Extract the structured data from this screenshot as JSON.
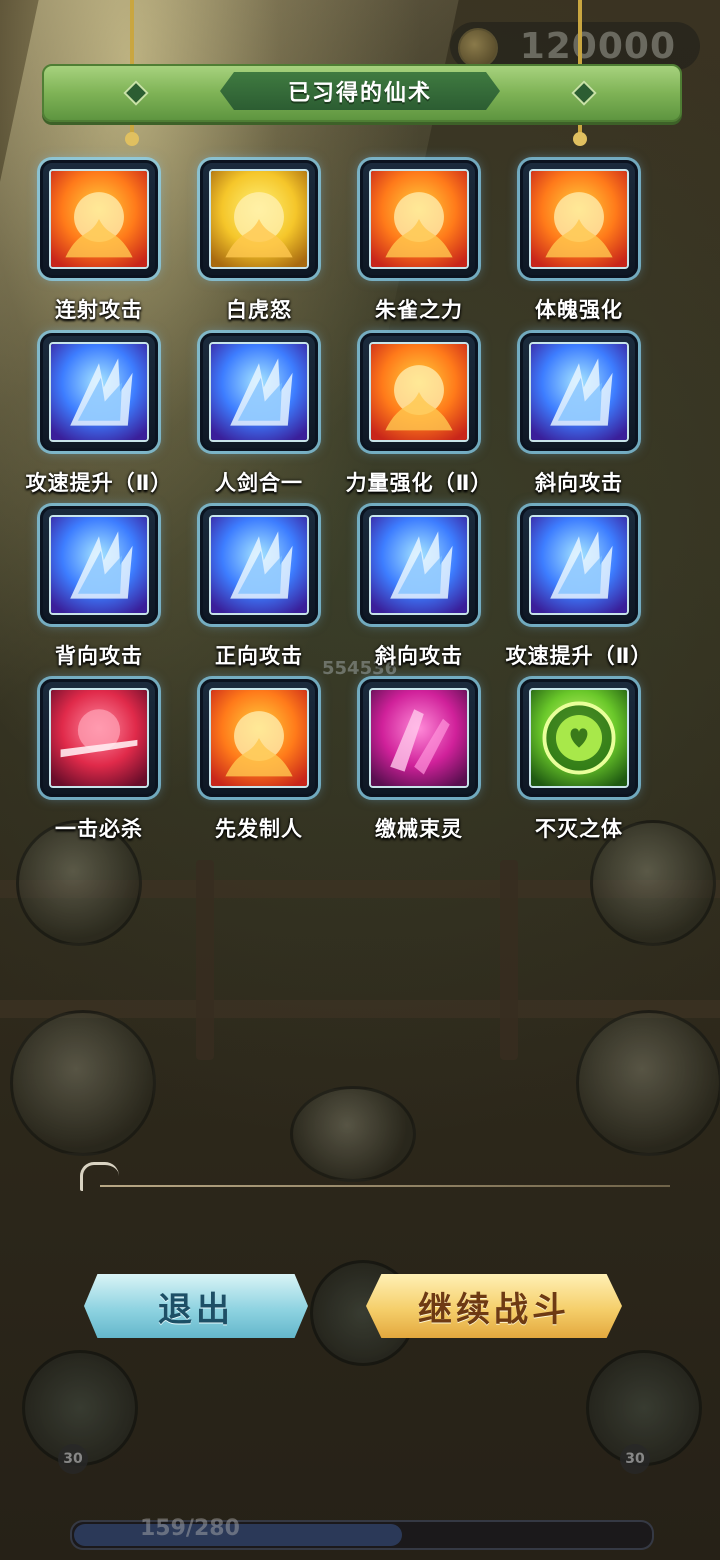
{
  "hud": {
    "coins": "120000",
    "hp_text": "159/280",
    "hp_fraction": 0.57,
    "damage_number": "554536",
    "skill_level_left": "30",
    "skill_level_right": "30"
  },
  "panel": {
    "title": "已习得的仙术"
  },
  "skills": [
    {
      "name": "连射攻击",
      "icon": "fire-orb-icon",
      "theme": "fire"
    },
    {
      "name": "白虎怒",
      "icon": "white-tiger-icon",
      "theme": "gold"
    },
    {
      "name": "朱雀之力",
      "icon": "vermilion-bird-icon",
      "theme": "fire"
    },
    {
      "name": "体魄强化",
      "icon": "body-strength-icon",
      "theme": "fire"
    },
    {
      "name": "攻速提升（Ⅱ）",
      "icon": "attack-speed-icon",
      "theme": "blue"
    },
    {
      "name": "人剑合一",
      "icon": "sword-man-icon",
      "theme": "blue"
    },
    {
      "name": "力量强化（Ⅱ）",
      "icon": "power-claw-icon",
      "theme": "fire"
    },
    {
      "name": "斜向攻击",
      "icon": "diagonal-attack-icon",
      "theme": "blue"
    },
    {
      "name": "背向攻击",
      "icon": "back-attack-icon",
      "theme": "blue"
    },
    {
      "name": "正向攻击",
      "icon": "forward-attack-icon",
      "theme": "blue"
    },
    {
      "name": "斜向攻击",
      "icon": "diagonal-attack-icon",
      "theme": "blue"
    },
    {
      "name": "攻速提升（Ⅱ）",
      "icon": "attack-speed-icon",
      "theme": "blue"
    },
    {
      "name": "一击必杀",
      "icon": "one-hit-kill-icon",
      "theme": "red"
    },
    {
      "name": "先发制人",
      "icon": "preemptive-strike-icon",
      "theme": "fire"
    },
    {
      "name": "缴械束灵",
      "icon": "disarm-icon",
      "theme": "magenta"
    },
    {
      "name": "不灭之体",
      "icon": "immortal-body-icon",
      "theme": "green"
    }
  ],
  "buttons": {
    "exit": "退出",
    "continue": "继续战斗"
  },
  "colors": {
    "banner": "#7fb356",
    "exit_button": "#8fd3e1",
    "continue_button": "#f5cf6b",
    "icon_glow": "#8cdcff"
  }
}
